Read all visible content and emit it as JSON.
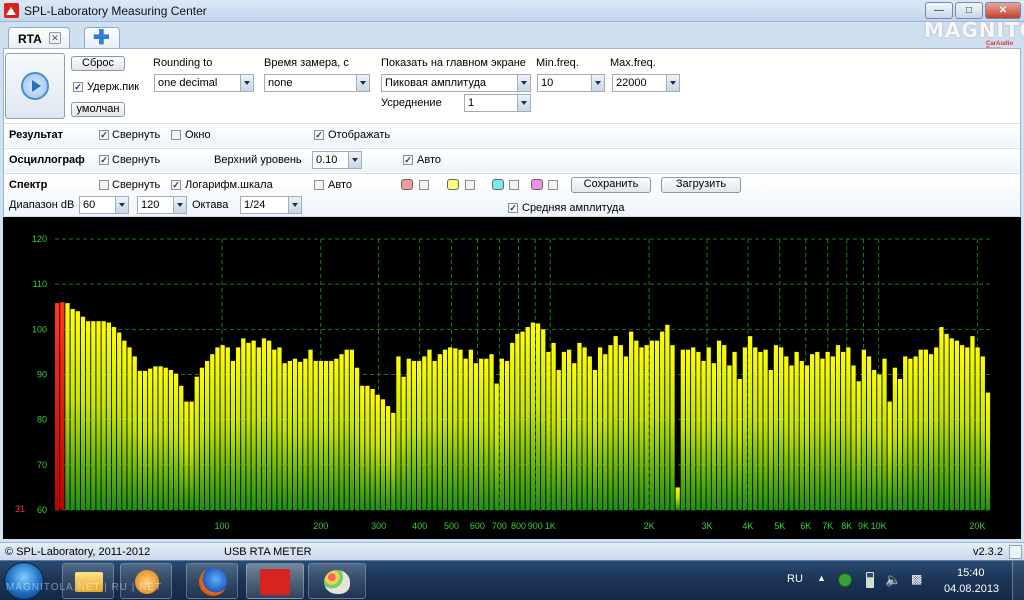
{
  "window": {
    "title": "SPL-Laboratory Measuring Center",
    "watermark": "MAGNITOLA",
    "watermark_sub": "CarAudio Team"
  },
  "tabs": [
    {
      "label": "RTA"
    }
  ],
  "controls": {
    "reset_label": "Сброс",
    "hold_peak_label": "Удерж.пик",
    "default_label": "умолчан",
    "rounding": {
      "label": "Rounding to",
      "value": "one decimal"
    },
    "measure_time": {
      "label": "Время замера, с",
      "value": "none"
    },
    "main_display": {
      "label": "Показать на главном экране",
      "value": "Пиковая амплитуда"
    },
    "averaging": {
      "label": "Усреднение",
      "value": "1"
    },
    "min_freq": {
      "label": "Min.freq.",
      "value": "10"
    },
    "max_freq": {
      "label": "Max.freq.",
      "value": "22000"
    }
  },
  "result_row": {
    "title": "Результат",
    "collapse_label": "Свернуть",
    "window_label": "Окно",
    "display_label": "Отображать"
  },
  "osc_row": {
    "title": "Осциллограф",
    "collapse_label": "Свернуть",
    "upper_level_label": "Верхний уровень",
    "upper_level_value": "0.10",
    "auto_label": "Авто"
  },
  "spectrum_row": {
    "title": "Спектр",
    "collapse_label": "Свернуть",
    "log_scale_label": "Логарифм.шкала",
    "auto_label": "Авто",
    "save_label": "Сохранить",
    "load_label": "Загрузить",
    "range_label": "Диапазон dB",
    "range_min": "60",
    "range_max": "120",
    "octave_label": "Октава",
    "octave_value": "1/24",
    "avg_amplitude_label": "Средняя амплитуда",
    "swatch_colors": [
      "#f39a9a",
      "#ffff80",
      "#7fe8ee",
      "#f08ee8"
    ]
  },
  "chart_data": {
    "type": "bar",
    "y_ticks": [
      "120",
      "110",
      "100",
      "90",
      "80",
      "70",
      "60"
    ],
    "ylim": [
      60,
      120
    ],
    "peak_readout": "31",
    "x_tick_labels": [
      "100",
      "200",
      "300",
      "400",
      "500",
      "600",
      "700",
      "800",
      "900",
      "1K",
      "2K",
      "3K",
      "4K",
      "5K",
      "6K",
      "7K",
      "8K",
      "9K",
      "10K",
      "20K"
    ],
    "grid": true,
    "values": [
      105.8,
      106.0,
      105.8,
      104.5,
      104.0,
      102.8,
      101.8,
      101.8,
      101.8,
      101.8,
      101.5,
      100.5,
      99.3,
      97.5,
      96.0,
      94.0,
      90.8,
      90.8,
      91.3,
      91.8,
      91.8,
      91.5,
      91.0,
      90.2,
      87.5,
      84.0,
      84.0,
      89.5,
      91.5,
      93.0,
      94.5,
      96.0,
      96.5,
      96.0,
      93.0,
      96.0,
      98.0,
      97.0,
      97.5,
      96.0,
      98.0,
      97.5,
      95.5,
      96.0,
      92.5,
      93.0,
      93.5,
      92.8,
      93.5,
      95.5,
      93.0,
      93.0,
      93.0,
      93.0,
      93.5,
      94.5,
      95.5,
      95.5,
      91.5,
      87.5,
      87.5,
      86.8,
      85.5,
      84.5,
      83.0,
      81.5,
      94.0,
      89.5,
      93.5,
      93.0,
      93.0,
      94.0,
      95.5,
      93.0,
      94.5,
      95.5,
      96.0,
      95.8,
      95.5,
      93.5,
      95.5,
      92.5,
      93.5,
      93.5,
      94.5,
      88.0,
      93.5,
      93.0,
      97.0,
      99.0,
      99.5,
      100.5,
      101.5,
      101.3,
      100.0,
      95.0,
      97.0,
      91.0,
      95.0,
      95.5,
      92.5,
      97.0,
      96.0,
      94.0,
      91.0,
      96.0,
      94.5,
      96.5,
      98.5,
      96.5,
      94.0,
      99.5,
      97.5,
      96.0,
      96.5,
      97.5,
      97.5,
      99.5,
      101.0,
      96.5,
      65.0,
      95.5,
      95.5,
      96.0,
      95.0,
      93.0,
      96.0,
      92.5,
      97.5,
      96.5,
      92.0,
      95.0,
      89.0,
      96.0,
      98.5,
      96.0,
      95.0,
      95.5,
      91.0,
      96.5,
      96.0,
      94.0,
      92.0,
      95.0,
      93.0,
      92.0,
      94.5,
      95.0,
      93.5,
      95.0,
      94.0,
      96.5,
      95.0,
      96.0,
      92.0,
      88.5,
      95.5,
      94.0,
      91.0,
      90.0,
      93.5,
      84.0,
      91.5,
      89.0,
      94.0,
      93.5,
      94.0,
      95.5,
      95.5,
      94.5,
      96.0,
      100.5,
      99.0,
      98.0,
      97.5,
      96.5,
      96.0,
      98.5,
      96.0,
      94.0,
      86.0
    ]
  },
  "status": {
    "copyright": "© SPL-Laboratory, 2011-2012",
    "device": "USB RTA METER",
    "version": "v2.3.2"
  },
  "taskbar": {
    "language": "RU",
    "time": "15:40",
    "date": "04.08.2013",
    "watermark": "MAGNITOLA.NET | RU | NET"
  }
}
